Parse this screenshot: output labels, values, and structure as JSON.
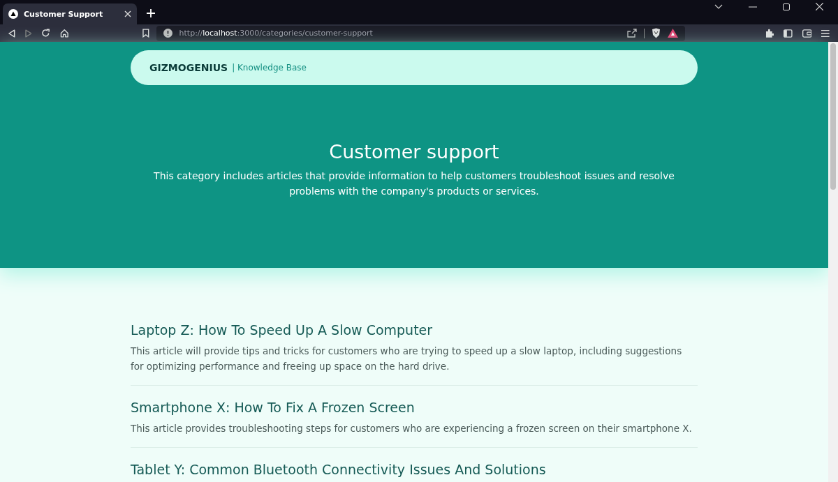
{
  "browser": {
    "tab": {
      "title": "Customer Support",
      "selected": true
    },
    "url": {
      "scheme": "http://",
      "host": "localhost",
      "path": ":3000/categories/customer-support"
    }
  },
  "header": {
    "brand": "GIZMOGENIUS",
    "subtitle": "| Knowledge Base"
  },
  "hero": {
    "title": "Customer support",
    "description": "This category includes articles that provide information to help customers troubleshoot issues and resolve problems with the company's products or services."
  },
  "articles": [
    {
      "title": "Laptop Z: How To Speed Up A Slow Computer",
      "summary": "This article will provide tips and tricks for customers who are trying to speed up a slow laptop, including suggestions for optimizing performance and freeing up space on the hard drive."
    },
    {
      "title": "Smartphone X: How To Fix A Frozen Screen",
      "summary": "This article provides troubleshooting steps for customers who are experiencing a frozen screen on their smartphone X."
    },
    {
      "title": "Tablet Y: Common Bluetooth Connectivity Issues And Solutions"
    }
  ]
}
